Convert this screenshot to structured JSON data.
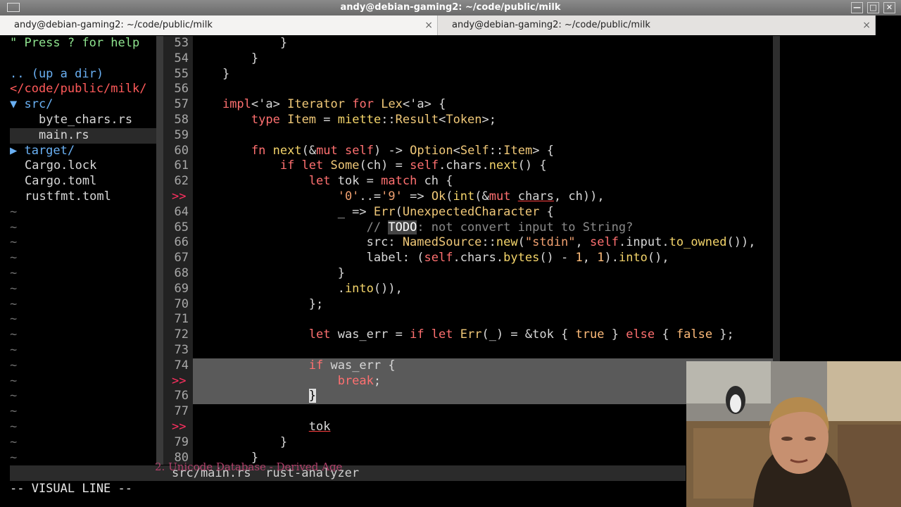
{
  "window": {
    "title": "andy@debian-gaming2: ~/code/public/milk"
  },
  "tabs": [
    {
      "label": "andy@debian-gaming2: ~/code/public/milk",
      "close": "×"
    },
    {
      "label": "andy@debian-gaming2: ~/code/public/milk",
      "close": "×"
    }
  ],
  "tree": {
    "help": "\" Press ? for help",
    "up": ".. (up a dir)",
    "cwd": "</code/public/milk/",
    "src": "▼ src/",
    "f1": "byte_chars.rs",
    "f2": "main.rs",
    "target": "▶ target/",
    "f3": "Cargo.lock",
    "f4": "Cargo.toml",
    "f5": "rustfmt.toml",
    "tilde": "~"
  },
  "gutter": [
    "53",
    "54",
    "55",
    "56",
    "57",
    "58",
    "59",
    "60",
    "61",
    "62",
    ">>",
    "64",
    "65",
    "66",
    "67",
    "68",
    "69",
    "70",
    "71",
    "72",
    "73",
    "74",
    ">>",
    "76",
    "77",
    ">>",
    "79",
    "80"
  ],
  "status": {
    "tree_part": "",
    "file": "src/main.rs",
    "lsp": "rust-analyzer"
  },
  "cmdline": "-- VISUAL LINE --",
  "below_text": "2.   Unicode Database - Derived Age"
}
